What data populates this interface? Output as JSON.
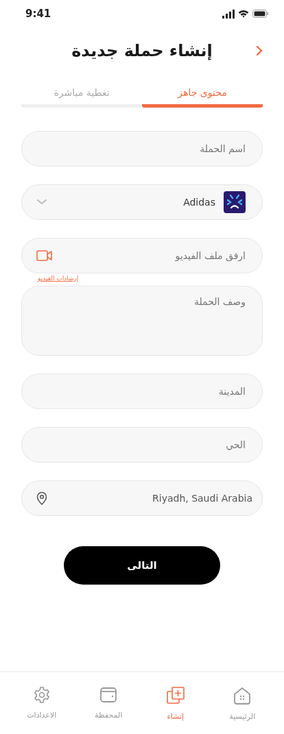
{
  "status_bar": {
    "time": "9:41"
  },
  "header": {
    "title": "إنشاء حملة جديدة"
  },
  "tabs": [
    {
      "label": "محتوى جاهز",
      "selected": true
    },
    {
      "label": "تغطية مباشرة",
      "selected": false
    }
  ],
  "form": {
    "campaign_name": {
      "placeholder": "اسم الحملة"
    },
    "brand": {
      "value": "Adidas"
    },
    "video": {
      "placeholder": "ارفق ملف الفيديو",
      "guide_link": "إرشادات الفيديو"
    },
    "description": {
      "placeholder": "وصف الحملة"
    },
    "city": {
      "placeholder": "المدينة"
    },
    "district": {
      "placeholder": "الحي"
    },
    "location": {
      "value": "Riyadh, Saudi Arabia"
    }
  },
  "next_button": "التالى",
  "bottom_nav": [
    {
      "label": "الرئيسية",
      "kind": "home",
      "selected": false
    },
    {
      "label": "إنشاء",
      "kind": "create",
      "selected": true
    },
    {
      "label": "المحفظة",
      "kind": "wallet",
      "selected": false
    },
    {
      "label": "الاعدادات",
      "kind": "settings",
      "selected": false
    }
  ]
}
